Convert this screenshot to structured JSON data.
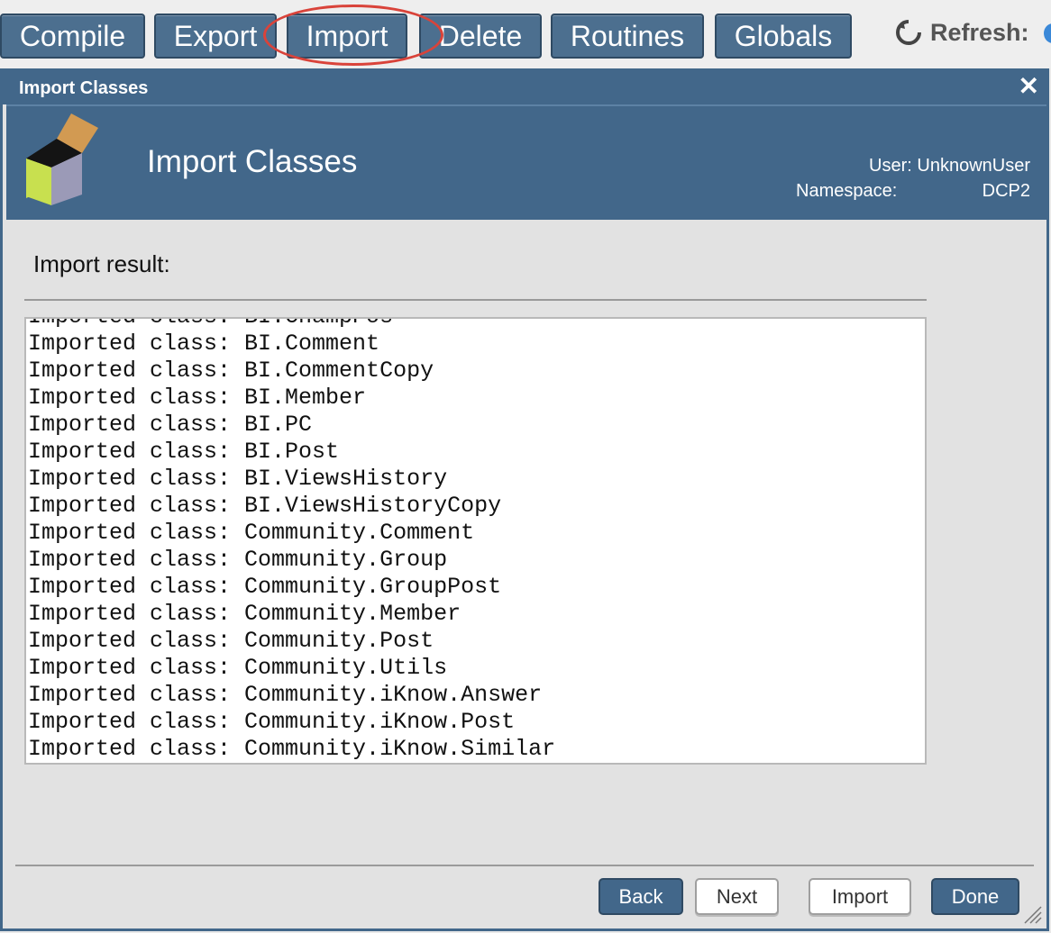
{
  "toolbar": {
    "buttons": [
      "Compile",
      "Export",
      "Import",
      "Delete",
      "Routines",
      "Globals"
    ],
    "refresh_label": "Refresh:"
  },
  "dialog": {
    "window_title": "Import Classes",
    "close_glyph": "✕",
    "banner_title": "Import Classes",
    "user_line": "User: UnknownUser",
    "namespace_label": "Namespace:",
    "namespace_value": "DCP2",
    "result_label": "Import result:",
    "log_lines": [
      "Imported class: BI.ChampPos",
      "Imported class: BI.Comment",
      "Imported class: BI.CommentCopy",
      "Imported class: BI.Member",
      "Imported class: BI.PC",
      "Imported class: BI.Post",
      "Imported class: BI.ViewsHistory",
      "Imported class: BI.ViewsHistoryCopy",
      "Imported class: Community.Comment",
      "Imported class: Community.Group",
      "Imported class: Community.GroupPost",
      "Imported class: Community.Member",
      "Imported class: Community.Post",
      "Imported class: Community.Utils",
      "Imported class: Community.iKnow.Answer",
      "Imported class: Community.iKnow.Post",
      "Imported class: Community.iKnow.Similar"
    ],
    "footer_buttons": {
      "back": "Back",
      "next": "Next",
      "import": "Import",
      "done": "Done"
    }
  },
  "icons": {
    "logo": "cube-icon",
    "refresh": "refresh-icon",
    "close": "close-icon",
    "resize": "resize-grip-icon"
  },
  "colors": {
    "accent": "#42678a",
    "highlight_ring": "#d9433a"
  }
}
